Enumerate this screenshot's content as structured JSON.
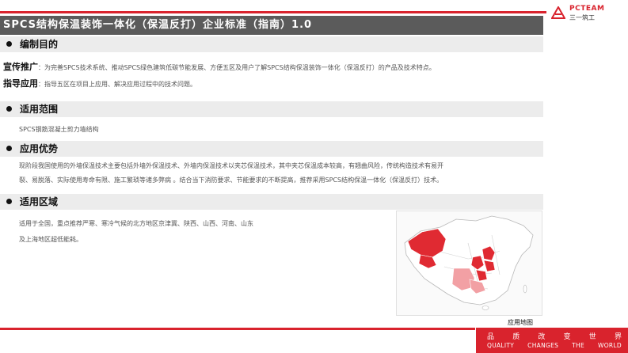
{
  "header": {
    "title": "SPCS结构保温装饰一体化（保温反打）企业标准（指南）1.0",
    "logo_en": "PCTEAM",
    "logo_cn": "三一筑工"
  },
  "sections": {
    "purpose": {
      "heading": "编制目的",
      "promo_label": "宣传推广",
      "promo_text": "：为完善SPCS技术系统、推动SPCS绿色建筑低碳节能发展、方便五区及用户了解SPCS结构保温装饰一体化（保温反打）的产品及技术特点。",
      "guide_label": "指导应用",
      "guide_text": "：指导五区在项目上应用、解决应用过程中的技术问题。"
    },
    "scope": {
      "heading": "适用范围",
      "text": "SPCS钢筋混凝土剪力墙结构"
    },
    "advantage": {
      "heading": "应用优势",
      "line1": "现阶段我国使用的外墙保温技术主要包括外墙外保温技术、外墙内保温技术以夹芯保温技术，其中夹芯保温成本较高，有翘曲风险，传统构造技术有易开",
      "line2": "裂、易脱落、实际使用寿命有限、施工繁琐等诸多弊病 。结合当下消防要求、节能要求的不断提高，推荐采用SPCS结构保温一体化（保温反打）技术。"
    },
    "region": {
      "heading": "适用区域",
      "line1": "适用于全国，重点推荐严寒、寒冷气候的北方地区京津冀、陕西、山西、河南、山东",
      "line2": "及上海地区超低能耗。",
      "map_caption": "应用地图"
    }
  },
  "footer": {
    "slogan_cn": [
      "品",
      "质",
      "改",
      "变",
      "世",
      "界"
    ],
    "slogan_en": [
      "QUALITY",
      "CHANGES",
      "THE",
      "WORLD"
    ]
  },
  "colors": {
    "accent_red": "#d9232d",
    "title_bar": "#5b5b5b",
    "section_bar": "#ececec",
    "map_highlight": "#e02a32",
    "map_light": "#f2a0a4"
  }
}
